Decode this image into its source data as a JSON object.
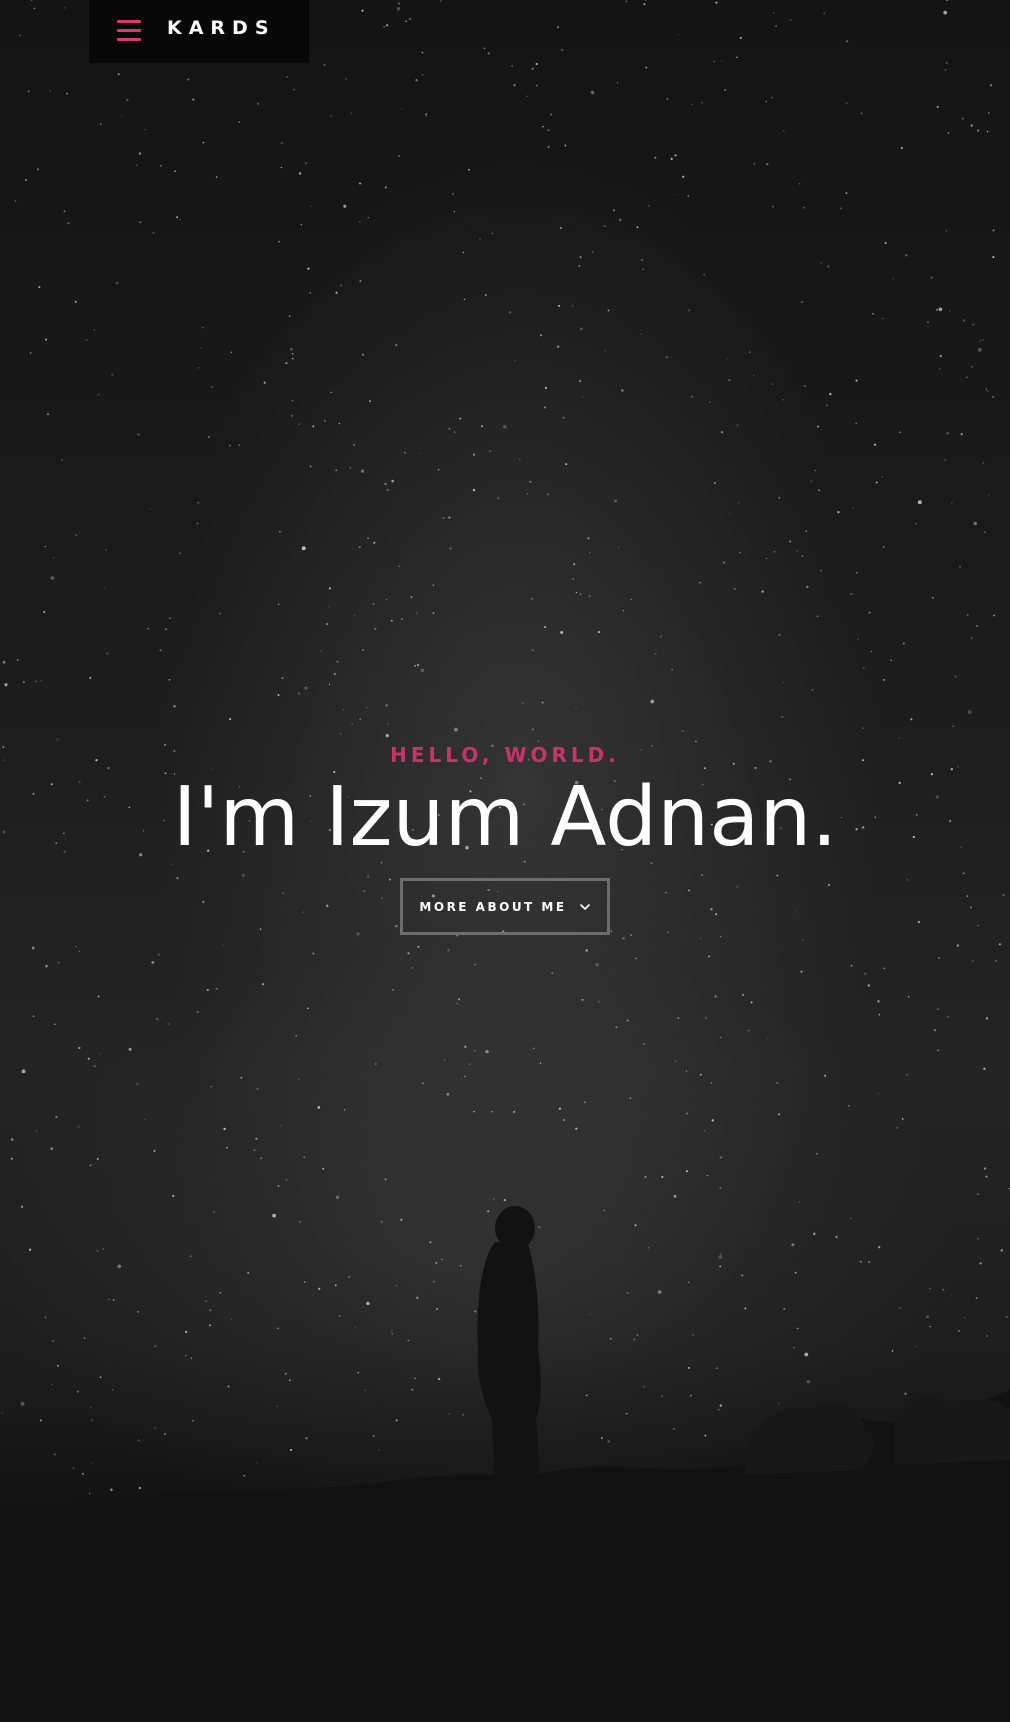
{
  "header": {
    "logo": "KARDS",
    "menu_icon": "hamburger-menu-icon",
    "accent_color": "#d63a76"
  },
  "hero": {
    "kicker": "HELLO, WORLD.",
    "headline": "I'm Izum Adnan.",
    "cta_label": "MORE ABOUT ME",
    "cta_icon": "chevron-down-icon",
    "kicker_color": "#c8336c",
    "background_image": "night-sky-milky-way-person-silhouette"
  }
}
